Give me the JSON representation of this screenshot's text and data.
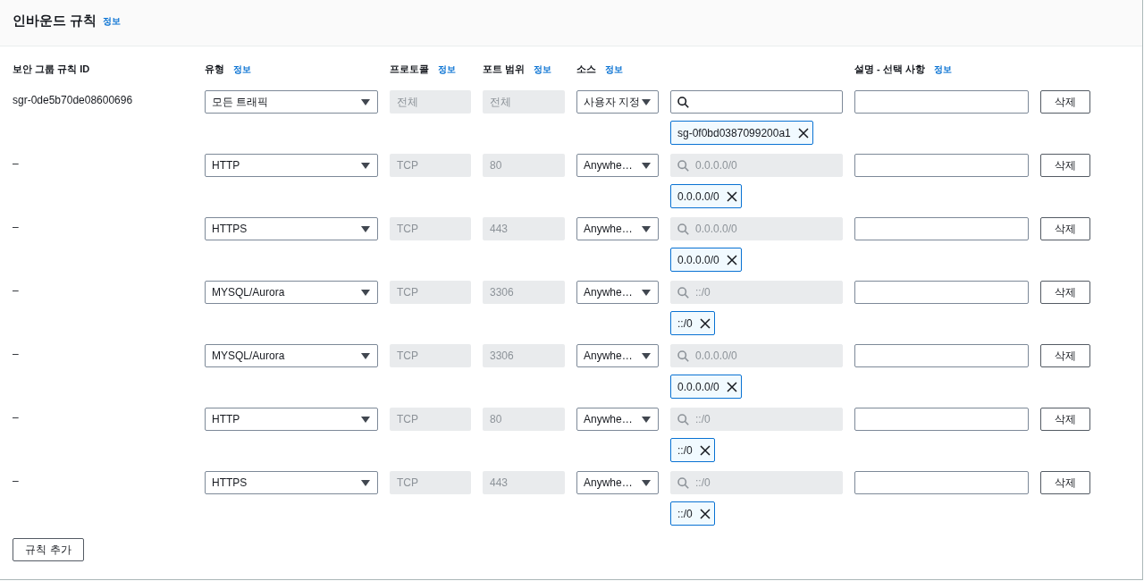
{
  "header": {
    "title": "인바운드 규칙",
    "info_link": "정보"
  },
  "columns": [
    {
      "label": "보안 그룹 규칙 ID"
    },
    {
      "label": "유형",
      "info_link": "정보"
    },
    {
      "label": "프로토콜",
      "info_link": "정보"
    },
    {
      "label": "포트 범위",
      "info_link": "정보"
    },
    {
      "label": "소스",
      "info_link": "정보"
    },
    {},
    {
      "label": "설명 - 선택 사항",
      "info_link": "정보"
    }
  ],
  "rules": [
    {
      "id": "sgr-0de5b70de08600696",
      "type": "모든 트래픽",
      "protocol": "전체",
      "port": "전체",
      "source": "사용자 지정",
      "search": {
        "disabled": false
      },
      "token": "sg-0f0bd0387099200a1",
      "delete": "삭제"
    },
    {
      "id": "–",
      "type": "HTTP",
      "protocol": "TCP",
      "port": "80",
      "source": "Anywhe…",
      "search": {
        "placeholder": "0.0.0.0/0",
        "disabled": true
      },
      "token": "0.0.0.0/0",
      "delete": "삭제"
    },
    {
      "id": "–",
      "type": "HTTPS",
      "protocol": "TCP",
      "port": "443",
      "source": "Anywhe…",
      "search": {
        "placeholder": "0.0.0.0/0",
        "disabled": true
      },
      "token": "0.0.0.0/0",
      "delete": "삭제"
    },
    {
      "id": "–",
      "type": "MYSQL/Aurora",
      "protocol": "TCP",
      "port": "3306",
      "source": "Anywhe…",
      "search": {
        "placeholder": "::/0",
        "disabled": true
      },
      "token": "::/0",
      "delete": "삭제"
    },
    {
      "id": "–",
      "type": "MYSQL/Aurora",
      "protocol": "TCP",
      "port": "3306",
      "source": "Anywhe…",
      "search": {
        "placeholder": "0.0.0.0/0",
        "disabled": true
      },
      "token": "0.0.0.0/0",
      "delete": "삭제"
    },
    {
      "id": "–",
      "type": "HTTP",
      "protocol": "TCP",
      "port": "80",
      "source": "Anywhe…",
      "search": {
        "placeholder": "::/0",
        "disabled": true
      },
      "token": "::/0",
      "delete": "삭제"
    },
    {
      "id": "–",
      "type": "HTTPS",
      "protocol": "TCP",
      "port": "443",
      "source": "Anywhe…",
      "search": {
        "placeholder": "::/0",
        "disabled": true
      },
      "token": "::/0",
      "delete": "삭제"
    }
  ],
  "add_button": "규칙 추가"
}
